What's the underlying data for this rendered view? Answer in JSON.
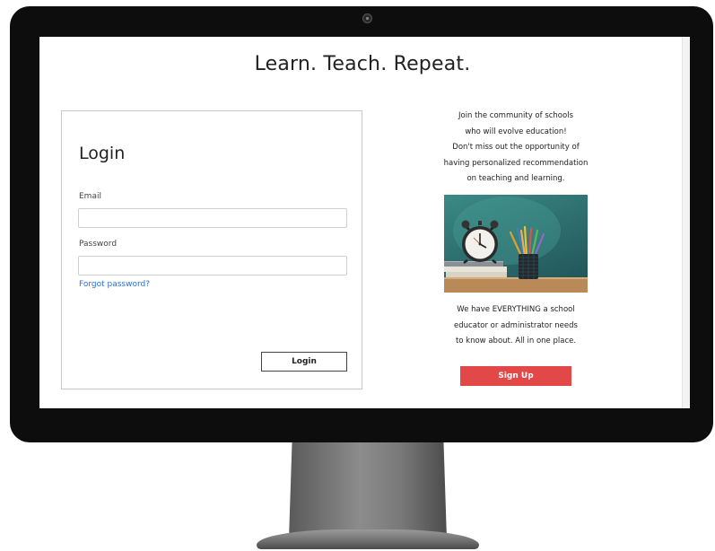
{
  "page": {
    "headline": "Learn. Teach. Repeat."
  },
  "login": {
    "title": "Login",
    "email_label": "Email",
    "email_value": "",
    "password_label": "Password",
    "password_value": "",
    "forgot_link": "Forgot password?",
    "submit_label": "Login"
  },
  "promo": {
    "intro_lines": [
      "Join the community of schools",
      "who will evolve education!",
      "Don't miss out the opportunity of",
      "having personalized recommendation",
      "on teaching and learning."
    ],
    "pitch_lines": [
      "We have EVERYTHING a school",
      "educator or administrator needs",
      "to know about. All in one place."
    ],
    "image_icon": "alarm-clock-and-pencils-photo",
    "signup_label": "Sign Up",
    "signup_color": "#e34848"
  },
  "device": {
    "frame": "desktop-monitor",
    "bezel_color": "#0d0d0d",
    "stand_color": "#7a7a7a"
  }
}
